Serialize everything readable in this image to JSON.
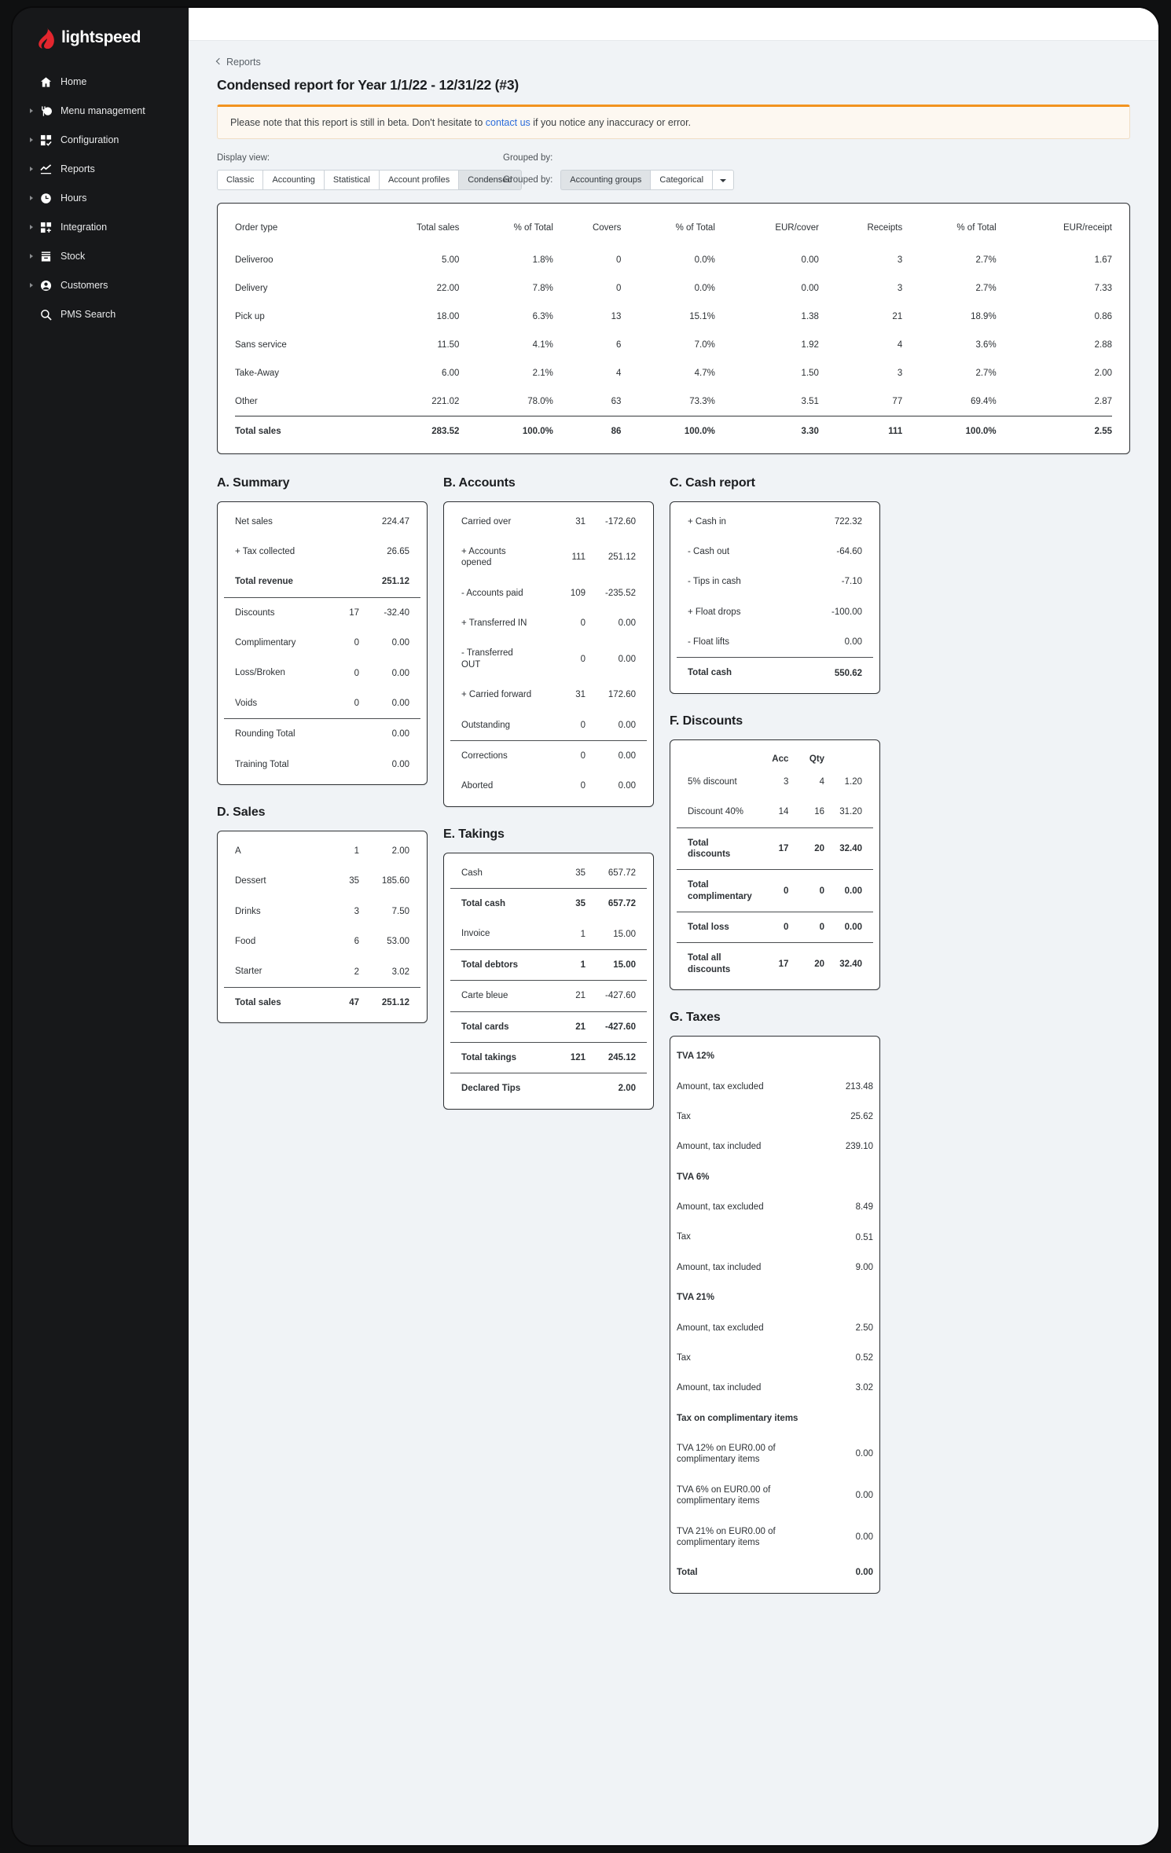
{
  "brand": {
    "name": "lightspeed"
  },
  "sidebar": {
    "items": [
      {
        "label": "Home",
        "icon": "home-icon",
        "expandable": false
      },
      {
        "label": "Menu management",
        "icon": "menu-management-icon",
        "expandable": true
      },
      {
        "label": "Configuration",
        "icon": "configuration-icon",
        "expandable": true
      },
      {
        "label": "Reports",
        "icon": "reports-chart-icon",
        "expandable": true
      },
      {
        "label": "Hours",
        "icon": "clock-icon",
        "expandable": true
      },
      {
        "label": "Integration",
        "icon": "integration-icon",
        "expandable": true
      },
      {
        "label": "Stock",
        "icon": "stock-box-icon",
        "expandable": true
      },
      {
        "label": "Customers",
        "icon": "customers-person-icon",
        "expandable": true
      },
      {
        "label": "PMS Search",
        "icon": "search-icon",
        "expandable": false
      }
    ]
  },
  "breadcrumb": {
    "label": "Reports"
  },
  "page": {
    "title": "Condensed report for Year 1/1/22 - 12/31/22 (#3)"
  },
  "banner": {
    "text_before": "Please note that this report is still in beta. Don't hesitate to ",
    "link": "contact us",
    "text_after": " if you notice any inaccuracy or error."
  },
  "controls": {
    "display_view_label": "Display view:",
    "display_views": [
      {
        "label": "Classic",
        "active": false
      },
      {
        "label": "Accounting",
        "active": false
      },
      {
        "label": "Statistical",
        "active": false
      },
      {
        "label": "Account profiles",
        "active": false
      },
      {
        "label": "Condensed",
        "active": true
      }
    ],
    "grouped_by_label": "Grouped by:",
    "grouped_by_inline_label": "Grouped by:",
    "grouped_by_options": [
      {
        "label": "Accounting groups",
        "active": true
      },
      {
        "label": "Categorical",
        "active": false
      }
    ],
    "dropdown_caret": "caret-down"
  },
  "order_table": {
    "headers": [
      "Order type",
      "Total sales",
      "% of Total",
      "Covers",
      "% of Total",
      "EUR/cover",
      "Receipts",
      "% of Total",
      "EUR/receipt"
    ],
    "rows": [
      [
        "Deliveroo",
        "5.00",
        "1.8%",
        "0",
        "0.0%",
        "0.00",
        "3",
        "2.7%",
        "1.67"
      ],
      [
        "Delivery",
        "22.00",
        "7.8%",
        "0",
        "0.0%",
        "0.00",
        "3",
        "2.7%",
        "7.33"
      ],
      [
        "Pick up",
        "18.00",
        "6.3%",
        "13",
        "15.1%",
        "1.38",
        "21",
        "18.9%",
        "0.86"
      ],
      [
        "Sans service",
        "11.50",
        "4.1%",
        "6",
        "7.0%",
        "1.92",
        "4",
        "3.6%",
        "2.88"
      ],
      [
        "Take-Away",
        "6.00",
        "2.1%",
        "4",
        "4.7%",
        "1.50",
        "3",
        "2.7%",
        "2.00"
      ],
      [
        "Other",
        "221.02",
        "78.0%",
        "63",
        "73.3%",
        "3.51",
        "77",
        "69.4%",
        "2.87"
      ]
    ],
    "total_row": [
      "Total sales",
      "283.52",
      "100.0%",
      "86",
      "100.0%",
      "3.30",
      "111",
      "100.0%",
      "2.55"
    ]
  },
  "sections": {
    "a": {
      "title": "A. Summary",
      "rows": [
        {
          "label": "Net sales",
          "mid": "",
          "value": "224.47",
          "bold": false,
          "topline": false
        },
        {
          "label": "+ Tax collected",
          "mid": "",
          "value": "26.65",
          "bold": false,
          "topline": false
        },
        {
          "label": "Total revenue",
          "mid": "",
          "value": "251.12",
          "bold": true,
          "topline": false
        },
        {
          "label": "Discounts",
          "mid": "17",
          "value": "-32.40",
          "bold": false,
          "topline": true
        },
        {
          "label": "Complimentary",
          "mid": "0",
          "value": "0.00",
          "bold": false,
          "topline": false
        },
        {
          "label": "Loss/Broken",
          "mid": "0",
          "value": "0.00",
          "bold": false,
          "topline": false
        },
        {
          "label": "Voids",
          "mid": "0",
          "value": "0.00",
          "bold": false,
          "topline": false
        },
        {
          "label": "Rounding Total",
          "mid": "",
          "value": "0.00",
          "bold": false,
          "topline": true
        },
        {
          "label": "Training Total",
          "mid": "",
          "value": "0.00",
          "bold": false,
          "topline": false
        }
      ]
    },
    "b": {
      "title": "B. Accounts",
      "rows": [
        {
          "label": "Carried over",
          "mid": "31",
          "value": "-172.60",
          "bold": false,
          "topline": false
        },
        {
          "label": "+ Accounts opened",
          "mid": "111",
          "value": "251.12",
          "bold": false,
          "topline": false
        },
        {
          "label": "- Accounts paid",
          "mid": "109",
          "value": "-235.52",
          "bold": false,
          "topline": false
        },
        {
          "label": "+ Transferred IN",
          "mid": "0",
          "value": "0.00",
          "bold": false,
          "topline": false
        },
        {
          "label": "- Transferred OUT",
          "mid": "0",
          "value": "0.00",
          "bold": false,
          "topline": false
        },
        {
          "label": "+ Carried forward",
          "mid": "31",
          "value": "172.60",
          "bold": false,
          "topline": false
        },
        {
          "label": "Outstanding",
          "mid": "0",
          "value": "0.00",
          "bold": false,
          "topline": false
        },
        {
          "label": "Corrections",
          "mid": "0",
          "value": "0.00",
          "bold": false,
          "topline": true
        },
        {
          "label": "Aborted",
          "mid": "0",
          "value": "0.00",
          "bold": false,
          "topline": false
        }
      ]
    },
    "c": {
      "title": "C. Cash report",
      "rows": [
        {
          "label": "+ Cash in",
          "mid": "",
          "value": "722.32",
          "bold": false,
          "topline": false
        },
        {
          "label": "- Cash out",
          "mid": "",
          "value": "-64.60",
          "bold": false,
          "topline": false
        },
        {
          "label": "- Tips in cash",
          "mid": "",
          "value": "-7.10",
          "bold": false,
          "topline": false
        },
        {
          "label": "+ Float drops",
          "mid": "",
          "value": "-100.00",
          "bold": false,
          "topline": false
        },
        {
          "label": "- Float lifts",
          "mid": "",
          "value": "0.00",
          "bold": false,
          "topline": false
        },
        {
          "label": "Total cash",
          "mid": "",
          "value": "550.62",
          "bold": true,
          "topline": true
        }
      ]
    },
    "d": {
      "title": "D. Sales",
      "rows": [
        {
          "label": "A",
          "mid": "1",
          "value": "2.00",
          "bold": false,
          "topline": false
        },
        {
          "label": "Dessert",
          "mid": "35",
          "value": "185.60",
          "bold": false,
          "topline": false
        },
        {
          "label": "Drinks",
          "mid": "3",
          "value": "7.50",
          "bold": false,
          "topline": false
        },
        {
          "label": "Food",
          "mid": "6",
          "value": "53.00",
          "bold": false,
          "topline": false
        },
        {
          "label": "Starter",
          "mid": "2",
          "value": "3.02",
          "bold": false,
          "topline": false
        },
        {
          "label": "Total sales",
          "mid": "47",
          "value": "251.12",
          "bold": true,
          "topline": true
        }
      ]
    },
    "e": {
      "title": "E. Takings",
      "rows": [
        {
          "label": "Cash",
          "mid": "35",
          "value": "657.72",
          "bold": false,
          "topline": false
        },
        {
          "label": "Total cash",
          "mid": "35",
          "value": "657.72",
          "bold": true,
          "topline": true
        },
        {
          "label": "Invoice",
          "mid": "1",
          "value": "15.00",
          "bold": false,
          "topline": false
        },
        {
          "label": "Total debtors",
          "mid": "1",
          "value": "15.00",
          "bold": true,
          "topline": true
        },
        {
          "label": "Carte bleue",
          "mid": "21",
          "value": "-427.60",
          "bold": false,
          "topline": true
        },
        {
          "label": "Total cards",
          "mid": "21",
          "value": "-427.60",
          "bold": true,
          "topline": true
        },
        {
          "label": "Total takings",
          "mid": "121",
          "value": "245.12",
          "bold": true,
          "topline": true
        },
        {
          "label": "Declared Tips",
          "mid": "",
          "value": "2.00",
          "bold": true,
          "topline": true
        }
      ]
    },
    "f": {
      "title": "F. Discounts",
      "headers": {
        "label": "",
        "acc": "Acc",
        "qty": "Qty",
        "amount": ""
      },
      "rows": [
        {
          "label": "5% discount",
          "acc": "3",
          "qty": "4",
          "value": "1.20",
          "bold": false,
          "topline": false
        },
        {
          "label": "Discount 40%",
          "acc": "14",
          "qty": "16",
          "value": "31.20",
          "bold": false,
          "topline": false
        },
        {
          "label": "Total discounts",
          "acc": "17",
          "qty": "20",
          "value": "32.40",
          "bold": true,
          "topline": true
        },
        {
          "label": "Total complimentary",
          "acc": "0",
          "qty": "0",
          "value": "0.00",
          "bold": true,
          "topline": true
        },
        {
          "label": "Total loss",
          "acc": "0",
          "qty": "0",
          "value": "0.00",
          "bold": true,
          "topline": true
        },
        {
          "label": "Total all discounts",
          "acc": "17",
          "qty": "20",
          "value": "32.40",
          "bold": true,
          "topline": true
        }
      ]
    },
    "g": {
      "title": "G. Taxes",
      "rows": [
        {
          "label": "TVA 12%",
          "value": "",
          "bold": true,
          "topline": false
        },
        {
          "label": "Amount, tax excluded",
          "value": "213.48",
          "bold": false,
          "topline": false
        },
        {
          "label": "Tax",
          "value": "25.62",
          "bold": false,
          "topline": false
        },
        {
          "label": "Amount, tax included",
          "value": "239.10",
          "bold": false,
          "topline": false
        },
        {
          "label": "TVA 6%",
          "value": "",
          "bold": true,
          "topline": false
        },
        {
          "label": "Amount, tax excluded",
          "value": "8.49",
          "bold": false,
          "topline": false
        },
        {
          "label": "Tax",
          "value": "0.51",
          "bold": false,
          "topline": false
        },
        {
          "label": "Amount, tax included",
          "value": "9.00",
          "bold": false,
          "topline": false
        },
        {
          "label": "TVA 21%",
          "value": "",
          "bold": true,
          "topline": false
        },
        {
          "label": "Amount, tax excluded",
          "value": "2.50",
          "bold": false,
          "topline": false
        },
        {
          "label": "Tax",
          "value": "0.52",
          "bold": false,
          "topline": false
        },
        {
          "label": "Amount, tax included",
          "value": "3.02",
          "bold": false,
          "topline": false
        },
        {
          "label": "Tax on complimentary items",
          "value": "",
          "bold": true,
          "topline": false
        },
        {
          "label": "TVA 12% on EUR0.00 of complimentary items",
          "value": "0.00",
          "bold": false,
          "topline": false
        },
        {
          "label": "TVA 6% on EUR0.00 of complimentary items",
          "value": "0.00",
          "bold": false,
          "topline": false
        },
        {
          "label": "TVA 21% on EUR0.00 of complimentary items",
          "value": "0.00",
          "bold": false,
          "topline": false
        },
        {
          "label": "Total",
          "value": "0.00",
          "bold": true,
          "topline": false
        }
      ]
    }
  },
  "colors": {
    "brand_red": "#E3262E",
    "sidebar_bg": "#17181A",
    "page_bg": "#F0F3F6",
    "link": "#2B6CDB",
    "banner_accent": "#F2931F"
  }
}
